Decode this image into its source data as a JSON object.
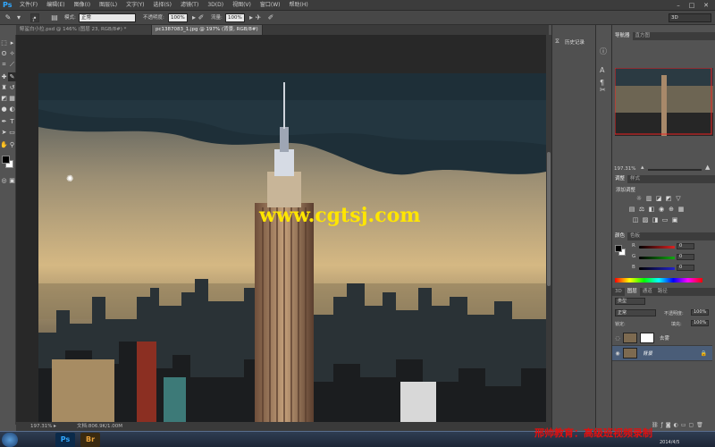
{
  "app": {
    "logo": "Ps"
  },
  "menu": [
    "文件(F)",
    "编辑(E)",
    "图像(I)",
    "图层(L)",
    "文字(Y)",
    "选择(S)",
    "滤镜(T)",
    "3D(D)",
    "视图(V)",
    "窗口(W)",
    "帮助(H)"
  ],
  "window_controls": {
    "minimize": "–",
    "maximize": "□",
    "close": "✕"
  },
  "options": {
    "mode_label": "模式:",
    "mode_value": "正常",
    "opacity_label": "不透明度:",
    "opacity_value": "100%",
    "flow_label": "流量:",
    "flow_value": "100%",
    "brush_size": "1",
    "workspace": "3D"
  },
  "tabs": [
    {
      "label": "鲸鲨白小拉.psd @ 146% (图层 23, RGB/8#) *"
    },
    {
      "label": "pc1387083_1.jpg @ 197% (背景, RGB/8#) *"
    }
  ],
  "status": {
    "zoom": "197.31%",
    "doc": "文档:806.9K/1.00M"
  },
  "canvas": {
    "watermark_url": "www.cgtsj.com"
  },
  "history_panel": {
    "label": "历史记录"
  },
  "navigator": {
    "tabs": [
      "导航器",
      "直方图"
    ],
    "zoom": "197.31%"
  },
  "adjustments": {
    "tabs": [
      "调整",
      "样式"
    ],
    "add_label": "添加调整"
  },
  "color": {
    "tabs": [
      "颜色",
      "色板"
    ],
    "r_label": "R",
    "g_label": "G",
    "b_label": "B",
    "r": "0",
    "g": "0",
    "b": "0",
    "colors": {
      "fg": "#000000",
      "bg": "#ffffff",
      "r_track": "#d22",
      "g_track": "#1a1",
      "b_track": "#22c"
    }
  },
  "layers": {
    "tabs": [
      "3D",
      "图层",
      "通道",
      "路径"
    ],
    "kind_label": "类型",
    "blend": "正常",
    "opacity_label": "不透明度:",
    "opacity": "100%",
    "lock_label": "锁定:",
    "fill_label": "填充:",
    "fill": "100%",
    "items": [
      {
        "name": "去雾"
      },
      {
        "name": "背景"
      }
    ]
  },
  "taskbar": {
    "apps": [
      {
        "label": "Ps",
        "color": "#31a8ff",
        "bg": "#0b2a4a"
      },
      {
        "label": "Br",
        "color": "#e9a23b",
        "bg": "#3a2a10"
      }
    ],
    "watermark": "邢帅教育：高级班视频录制",
    "date": "2014/4/5"
  }
}
